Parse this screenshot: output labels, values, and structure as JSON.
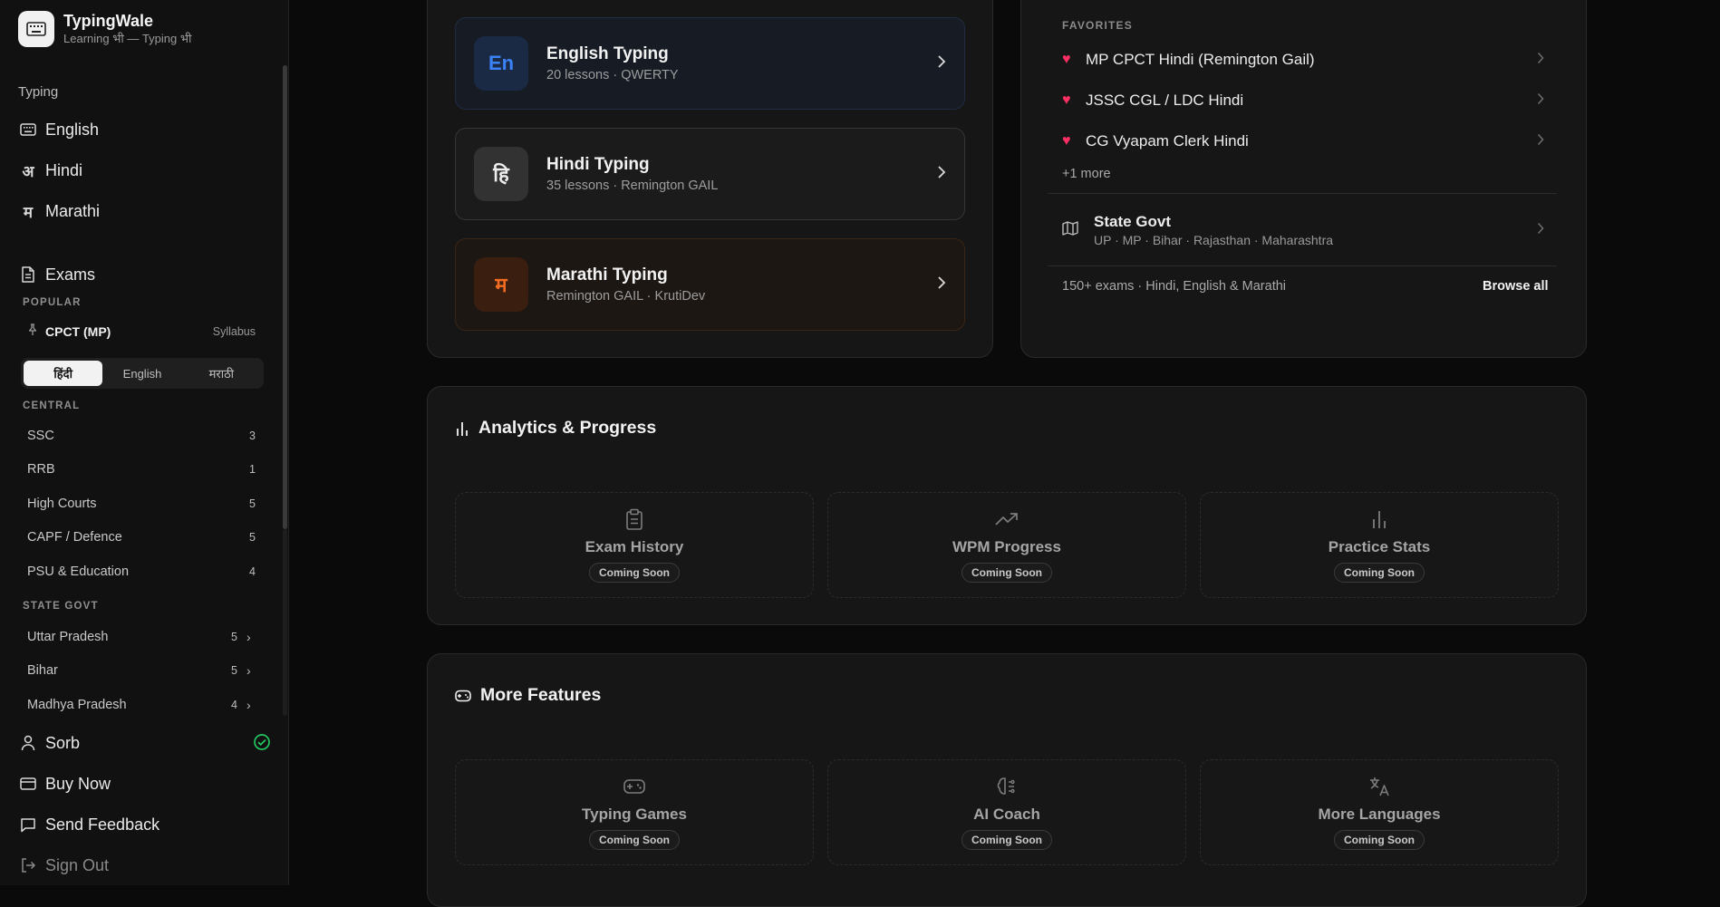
{
  "brand": {
    "name": "TypingWale",
    "tagline": "Learning भी — Typing भी"
  },
  "sidebar": {
    "typing_section": "Typing",
    "typing_items": [
      {
        "label": "English",
        "icon": "keyboard-icon"
      },
      {
        "label": "Hindi",
        "icon_glyph": "अ"
      },
      {
        "label": "Marathi",
        "icon_glyph": "म"
      }
    ],
    "exams_label": "Exams",
    "popular_label": "POPULAR",
    "cpct": {
      "name": "CPCT (MP)",
      "syllabus": "Syllabus"
    },
    "lang_segments": [
      "हिंदी",
      "English",
      "मराठी"
    ],
    "central_label": "CENTRAL",
    "central": [
      {
        "label": "SSC",
        "count": "3"
      },
      {
        "label": "RRB",
        "count": "1"
      },
      {
        "label": "High Courts",
        "count": "5"
      },
      {
        "label": "CAPF / Defence",
        "count": "5"
      },
      {
        "label": "PSU & Education",
        "count": "4"
      }
    ],
    "state_label": "STATE GOVT",
    "state": [
      {
        "label": "Uttar Pradesh",
        "count": "5"
      },
      {
        "label": "Bihar",
        "count": "5"
      },
      {
        "label": "Madhya Pradesh",
        "count": "4"
      }
    ],
    "user": "Sorb",
    "buy_now": "Buy Now",
    "feedback": "Send Feedback",
    "sign_out": "Sign Out"
  },
  "lessons": [
    {
      "badge": "En",
      "title": "English Typing",
      "sub": "20 lessons · QWERTY"
    },
    {
      "badge": "हि",
      "title": "Hindi Typing",
      "sub": "35 lessons · Remington GAIL"
    },
    {
      "badge": "म",
      "title": "Marathi Typing",
      "sub": "Remington GAIL · KrutiDev"
    }
  ],
  "favorites": {
    "label": "FAVORITES",
    "items": [
      "MP CPCT Hindi (Remington Gail)",
      "JSSC CGL / LDC Hindi",
      "CG Vyapam Clerk Hindi"
    ],
    "more": "+1 more",
    "state_title": "State Govt",
    "state_sub": "UP · MP · Bihar · Rajasthan · Maharashtra",
    "footnote": "150+ exams · Hindi, English & Marathi",
    "browse": "Browse all"
  },
  "analytics": {
    "title": "Analytics & Progress",
    "tiles": [
      {
        "title": "Exam History",
        "badge": "Coming Soon"
      },
      {
        "title": "WPM Progress",
        "badge": "Coming Soon"
      },
      {
        "title": "Practice Stats",
        "badge": "Coming Soon"
      }
    ]
  },
  "features": {
    "title": "More Features",
    "tiles": [
      {
        "title": "Typing Games",
        "badge": "Coming Soon"
      },
      {
        "title": "AI Coach",
        "badge": "Coming Soon"
      },
      {
        "title": "More Languages",
        "badge": "Coming Soon"
      }
    ]
  },
  "colors": {
    "accent_en": "#3b82f6",
    "accent_mr": "#f26b21",
    "heart": "#ff2e63",
    "verified": "#22c55e"
  }
}
